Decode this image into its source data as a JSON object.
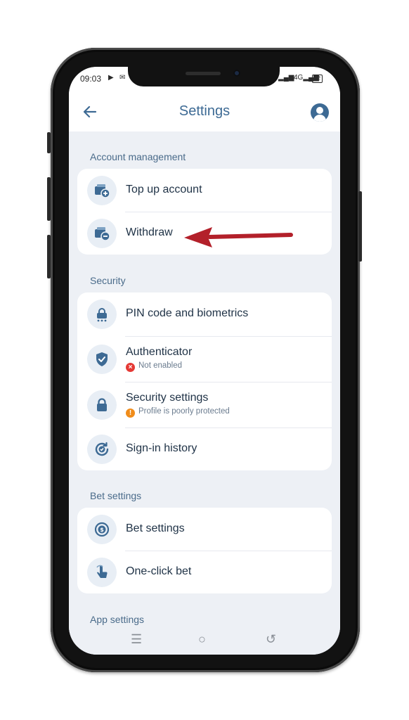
{
  "status_bar": {
    "time": "09:03",
    "battery": "82"
  },
  "header": {
    "title": "Settings",
    "back_icon": "arrow-left-icon",
    "profile_icon": "user-circle-icon"
  },
  "sections": [
    {
      "title": "Account management",
      "items": [
        {
          "label": "Top up account",
          "icon": "wallet-plus-icon"
        },
        {
          "label": "Withdraw",
          "icon": "wallet-minus-icon"
        }
      ]
    },
    {
      "title": "Security",
      "items": [
        {
          "label": "PIN code and biometrics",
          "icon": "lock-keypad-icon"
        },
        {
          "label": "Authenticator",
          "icon": "shield-check-icon",
          "sub": "Not enabled",
          "sub_icon": "error-icon",
          "sub_color": "#e53935"
        },
        {
          "label": "Security settings",
          "icon": "lock-icon",
          "sub": "Profile is poorly protected",
          "sub_icon": "warning-icon",
          "sub_color": "#f08c1a"
        },
        {
          "label": "Sign-in history",
          "icon": "history-icon"
        }
      ]
    },
    {
      "title": "Bet settings",
      "items": [
        {
          "label": "Bet settings",
          "icon": "coin-dollar-icon"
        },
        {
          "label": "One-click bet",
          "icon": "tap-icon"
        }
      ]
    },
    {
      "title": "App settings",
      "items": []
    }
  ],
  "annotation": {
    "icon": "red-arrow-pointer",
    "color": "#b3202a"
  },
  "colors": {
    "accent": "#3d6a94",
    "background": "#edf0f5",
    "card": "#ffffff",
    "text": "#1f3246"
  }
}
